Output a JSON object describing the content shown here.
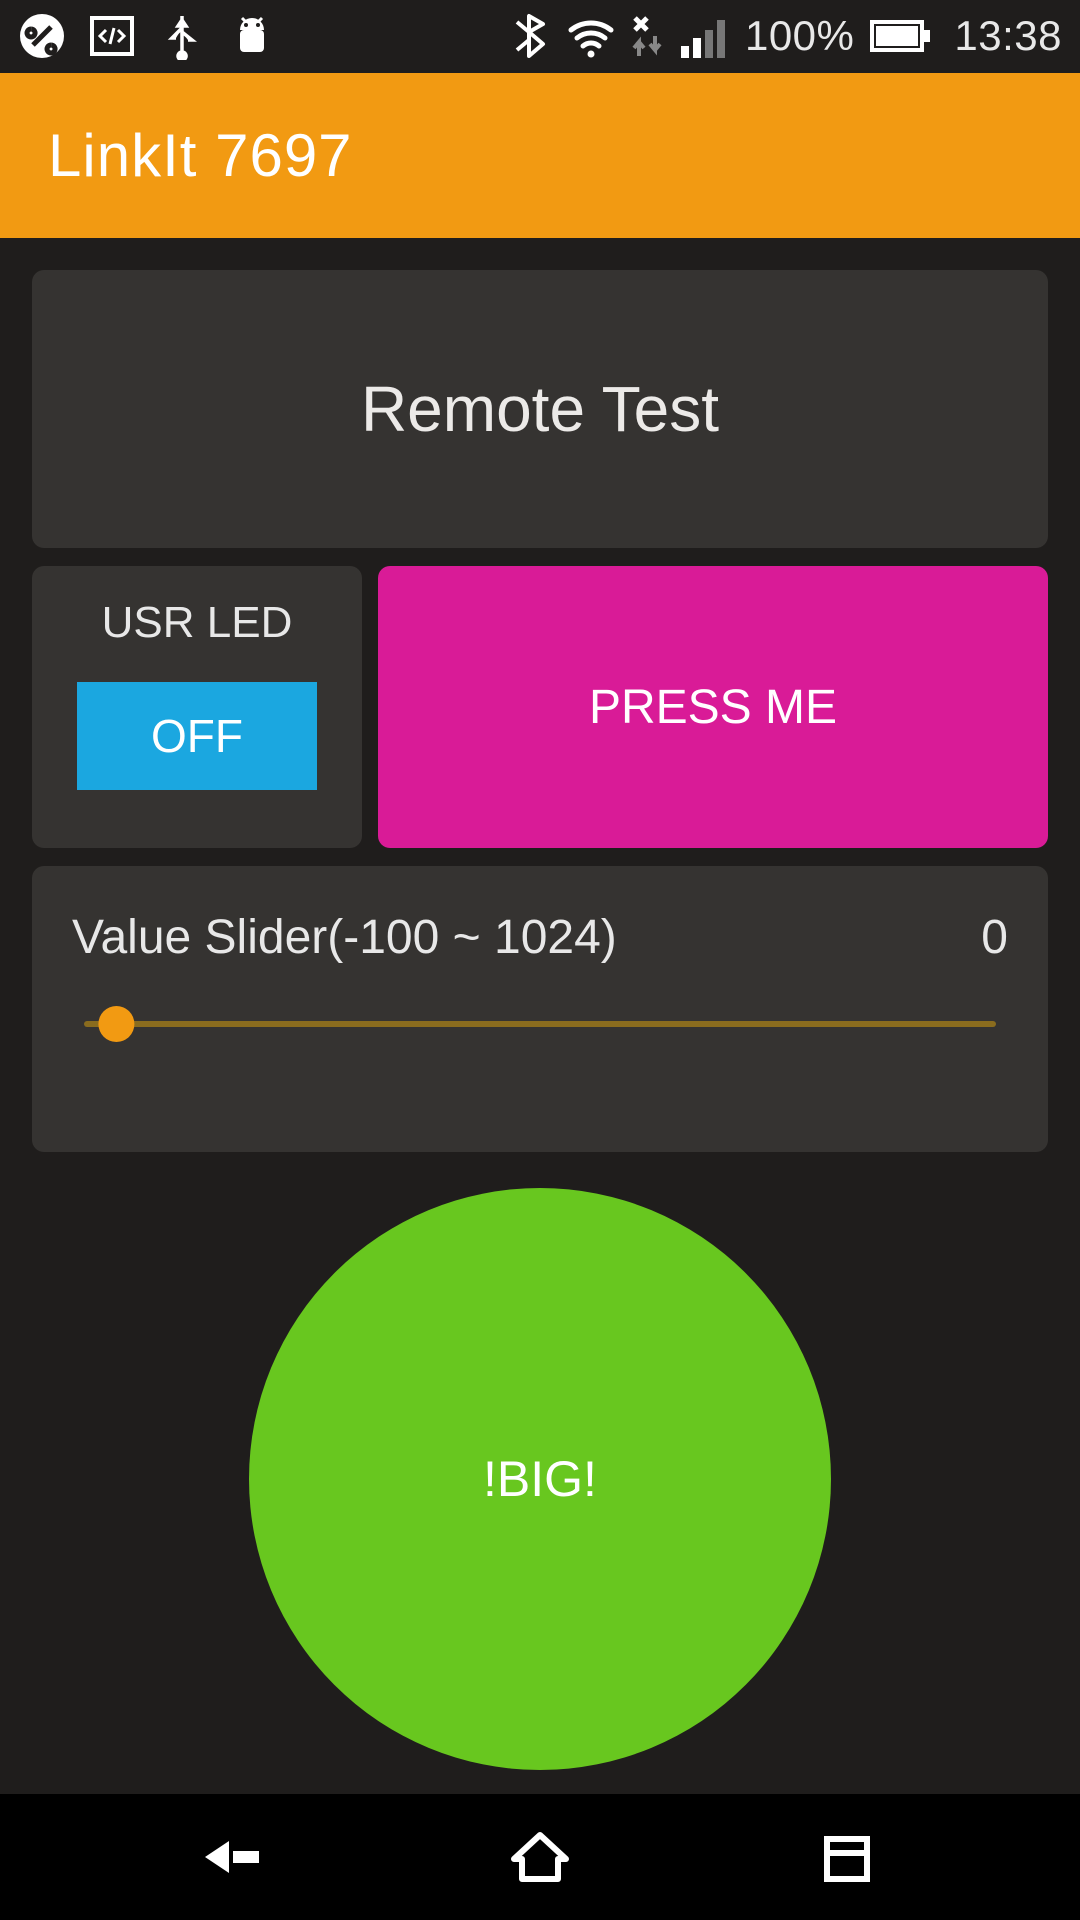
{
  "statusbar": {
    "icons_left": [
      "app-icon",
      "devtools-icon",
      "usb-icon",
      "android-debug-icon"
    ],
    "icons_right": [
      "bluetooth-icon",
      "wifi-icon",
      "no-data-icon",
      "signal-bars-icon"
    ],
    "battery_pct": "100%",
    "battery_icon": "battery-full-icon",
    "clock": "13:38"
  },
  "titlebar": {
    "title": "LinkIt 7697"
  },
  "main": {
    "panel_title": "Remote Test",
    "usr_led": {
      "label": "USR LED",
      "state_label": "OFF"
    },
    "press_button_label": "PRESS ME",
    "slider": {
      "label": "Value Slider(-100 ~ 1024)",
      "value": "0",
      "min": -100,
      "max": 1024,
      "thumb_percent": 2
    },
    "big_button_label": "!BIG!"
  },
  "navbar": {
    "back": "back",
    "home": "home",
    "recent": "recent"
  }
}
